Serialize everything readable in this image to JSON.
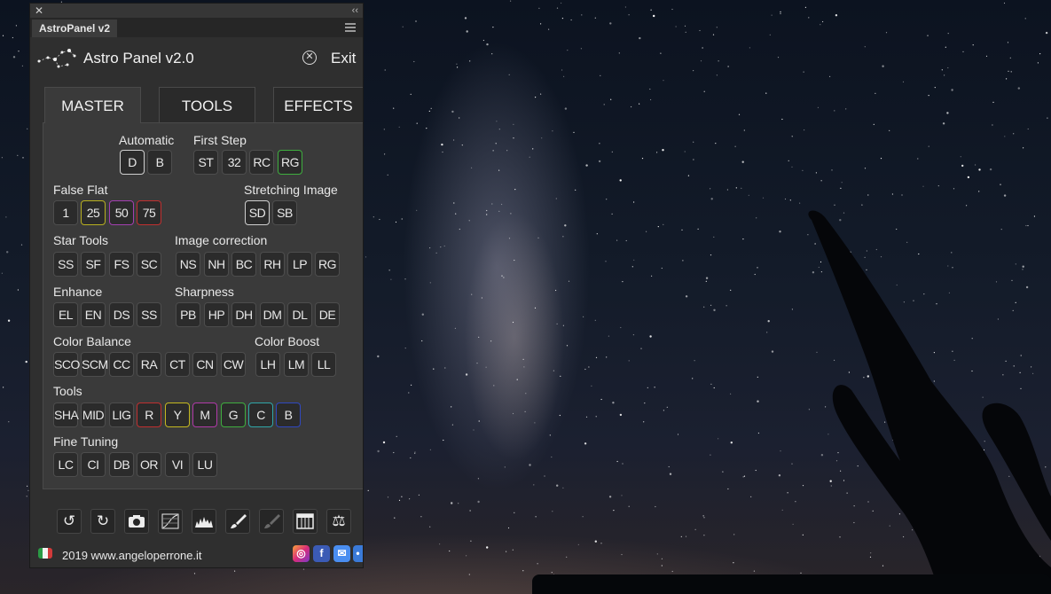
{
  "panel": {
    "tab_title": "AstroPanel v2",
    "app_title": "Astro Panel v2.0",
    "exit_label": "Exit"
  },
  "tabs": [
    "MASTER",
    "TOOLS",
    "EFFECTS"
  ],
  "labels": {
    "automatic": "Automatic",
    "first_step": "First Step",
    "false_flat": "False Flat",
    "stretching": "Stretching Image",
    "star_tools": "Star Tools",
    "image_correction": "Image correction",
    "enhance": "Enhance",
    "sharpness": "Sharpness",
    "color_balance": "Color Balance",
    "color_boost": "Color Boost",
    "tools": "Tools",
    "fine_tuning": "Fine Tuning"
  },
  "buttons": {
    "automatic": [
      "D",
      "B"
    ],
    "first_step": [
      "ST",
      "32",
      "RC",
      "RG"
    ],
    "false_flat": [
      "1",
      "25",
      "50",
      "75"
    ],
    "stretching": [
      "SD",
      "SB"
    ],
    "star_tools": [
      "SS",
      "SF",
      "FS",
      "SC"
    ],
    "image_correction": [
      "NS",
      "NH",
      "BC",
      "RH",
      "LP",
      "RG"
    ],
    "enhance": [
      "EL",
      "EN",
      "DS",
      "SS"
    ],
    "sharpness": [
      "PB",
      "HP",
      "DH",
      "DM",
      "DL",
      "DE"
    ],
    "color_balance": [
      "SCO",
      "SCM",
      "CC",
      "RA",
      "CT",
      "CN",
      "CW"
    ],
    "color_boost": [
      "LH",
      "LM",
      "LL"
    ],
    "tools": [
      "SHA",
      "MID",
      "LIG",
      "R",
      "Y",
      "M",
      "G",
      "C",
      "B"
    ],
    "fine_tuning": [
      "LC",
      "CI",
      "DB",
      "OR",
      "VI",
      "LU"
    ]
  },
  "button_colors": {
    "first_step_rg": "#3fae3f",
    "false_flat_25": "#b8b020",
    "false_flat_50": "#a33fb0",
    "false_flat_75": "#c03030",
    "tools_r": "#c03030",
    "tools_y": "#c4b820",
    "tools_m": "#b03aa8",
    "tools_g": "#3fae3f",
    "tools_c": "#2fa7a8",
    "tools_b": "#3048c0"
  },
  "toolbar_icons": [
    "undo-icon",
    "redo-icon",
    "camera-icon",
    "curves-icon",
    "histogram-icon",
    "brush-icon",
    "brush-dark-icon",
    "filmstrip-icon",
    "balance-scale-icon"
  ],
  "footer": {
    "text": "2019 www.angeloperrone.it",
    "socials": [
      "instagram-icon",
      "facebook-icon",
      "mail-icon",
      "share-icon"
    ]
  }
}
